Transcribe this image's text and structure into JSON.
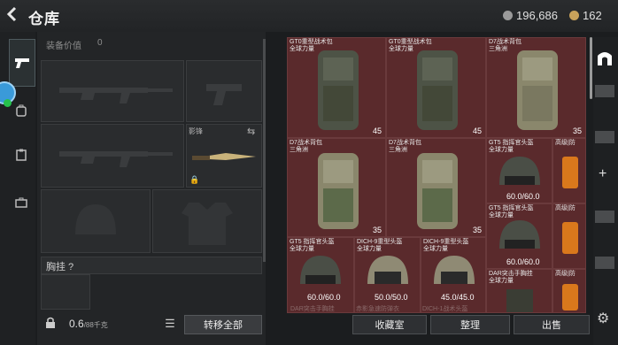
{
  "header": {
    "title": "仓库",
    "currency_1": "196,686",
    "currency_2": "162"
  },
  "equipment": {
    "value_label": "装备价值",
    "value": "0",
    "melee_label": "影锋",
    "rig_label": "胸挂 ?"
  },
  "footer": {
    "weight": "0.6",
    "weight_unit": "/88千克",
    "move_all": "转移全部"
  },
  "inventory": {
    "cells": [
      {
        "name": "GT0重型战术包\n全球力量",
        "count": "45"
      },
      {
        "name": "GT0重型战术包\n全球力量",
        "count": "45"
      },
      {
        "name": "D7战术背包\n三角洲",
        "count": "35"
      },
      {
        "name": "D7战术背包\n三角洲",
        "count": "35"
      },
      {
        "name": "D7战术背包\n三角洲",
        "count": "35"
      },
      {
        "name": "GT5 指挥官头盔\n全球力量",
        "durability": "60.0/60.0"
      },
      {
        "name": "高级|防",
        "durability": ""
      },
      {
        "name": "GT5 指挥官头盔\n全球力量",
        "durability": "60.0/60.0"
      },
      {
        "name": "高级|防",
        "durability": ""
      },
      {
        "name": "GT5 指挥官头盔\n全球力量",
        "durability": "60.0/60.0"
      },
      {
        "name": "DICH-9重型头盔\n全球力量",
        "durability": "50.0/50.0"
      },
      {
        "name": "DICH-9重型头盔\n全球力量",
        "durability": "45.0/45.0"
      },
      {
        "name": "DAR突击手胸挂\n全球力量",
        "durability": ""
      },
      {
        "name": "高级|防",
        "durability": ""
      },
      {
        "name": "DAR突击手胸挂",
        "durability": ""
      },
      {
        "name": "赤影急速防弹衣",
        "durability": ""
      },
      {
        "name": "DICH-1战术头盔",
        "durability": ""
      }
    ]
  },
  "actions": {
    "favorites": "收藏室",
    "sort": "整理",
    "sell": "出售"
  },
  "icons": [
    "back-icon",
    "coin-icon",
    "gold-coin-icon",
    "pistol-icon",
    "backpack-icon",
    "clipboard-icon",
    "briefcase-icon",
    "lock-icon",
    "swap-icon",
    "list-icon",
    "archway-icon",
    "plus-icon",
    "gear-icon"
  ],
  "colors": {
    "grid_bg": "#4a2224",
    "cell_bg": "#5a2a2c",
    "accent": "#3a9ad9"
  }
}
